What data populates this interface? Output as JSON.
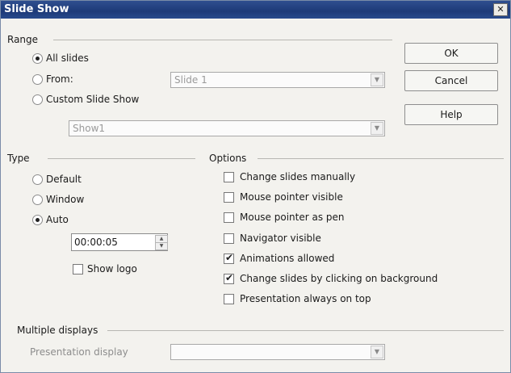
{
  "window": {
    "title": "Slide Show",
    "close_glyph": "✕"
  },
  "range": {
    "title": "Range",
    "all_slides": "All slides",
    "from": "From:",
    "from_value": "Slide 1",
    "custom_show": "Custom Slide Show",
    "custom_value": "Show1"
  },
  "buttons": {
    "ok": "OK",
    "cancel": "Cancel",
    "help": "Help"
  },
  "type": {
    "title": "Type",
    "default": "Default",
    "window": "Window",
    "auto": "Auto",
    "time": "00:00:05",
    "show_logo": "Show logo"
  },
  "options": {
    "title": "Options",
    "items": [
      {
        "label": "Change slides manually",
        "checked": false
      },
      {
        "label": "Mouse pointer visible",
        "checked": false
      },
      {
        "label": "Mouse pointer as pen",
        "checked": false
      },
      {
        "label": "Navigator visible",
        "checked": false
      },
      {
        "label": "Animations allowed",
        "checked": true
      },
      {
        "label": "Change slides by clicking on background",
        "checked": true
      },
      {
        "label": "Presentation always on top",
        "checked": false
      }
    ]
  },
  "multiple_displays": {
    "title": "Multiple displays",
    "presentation_display": "Presentation display"
  },
  "glyphs": {
    "check": "✔",
    "down_arrow": "▼",
    "spin_up": "▲",
    "spin_down": "▼"
  }
}
